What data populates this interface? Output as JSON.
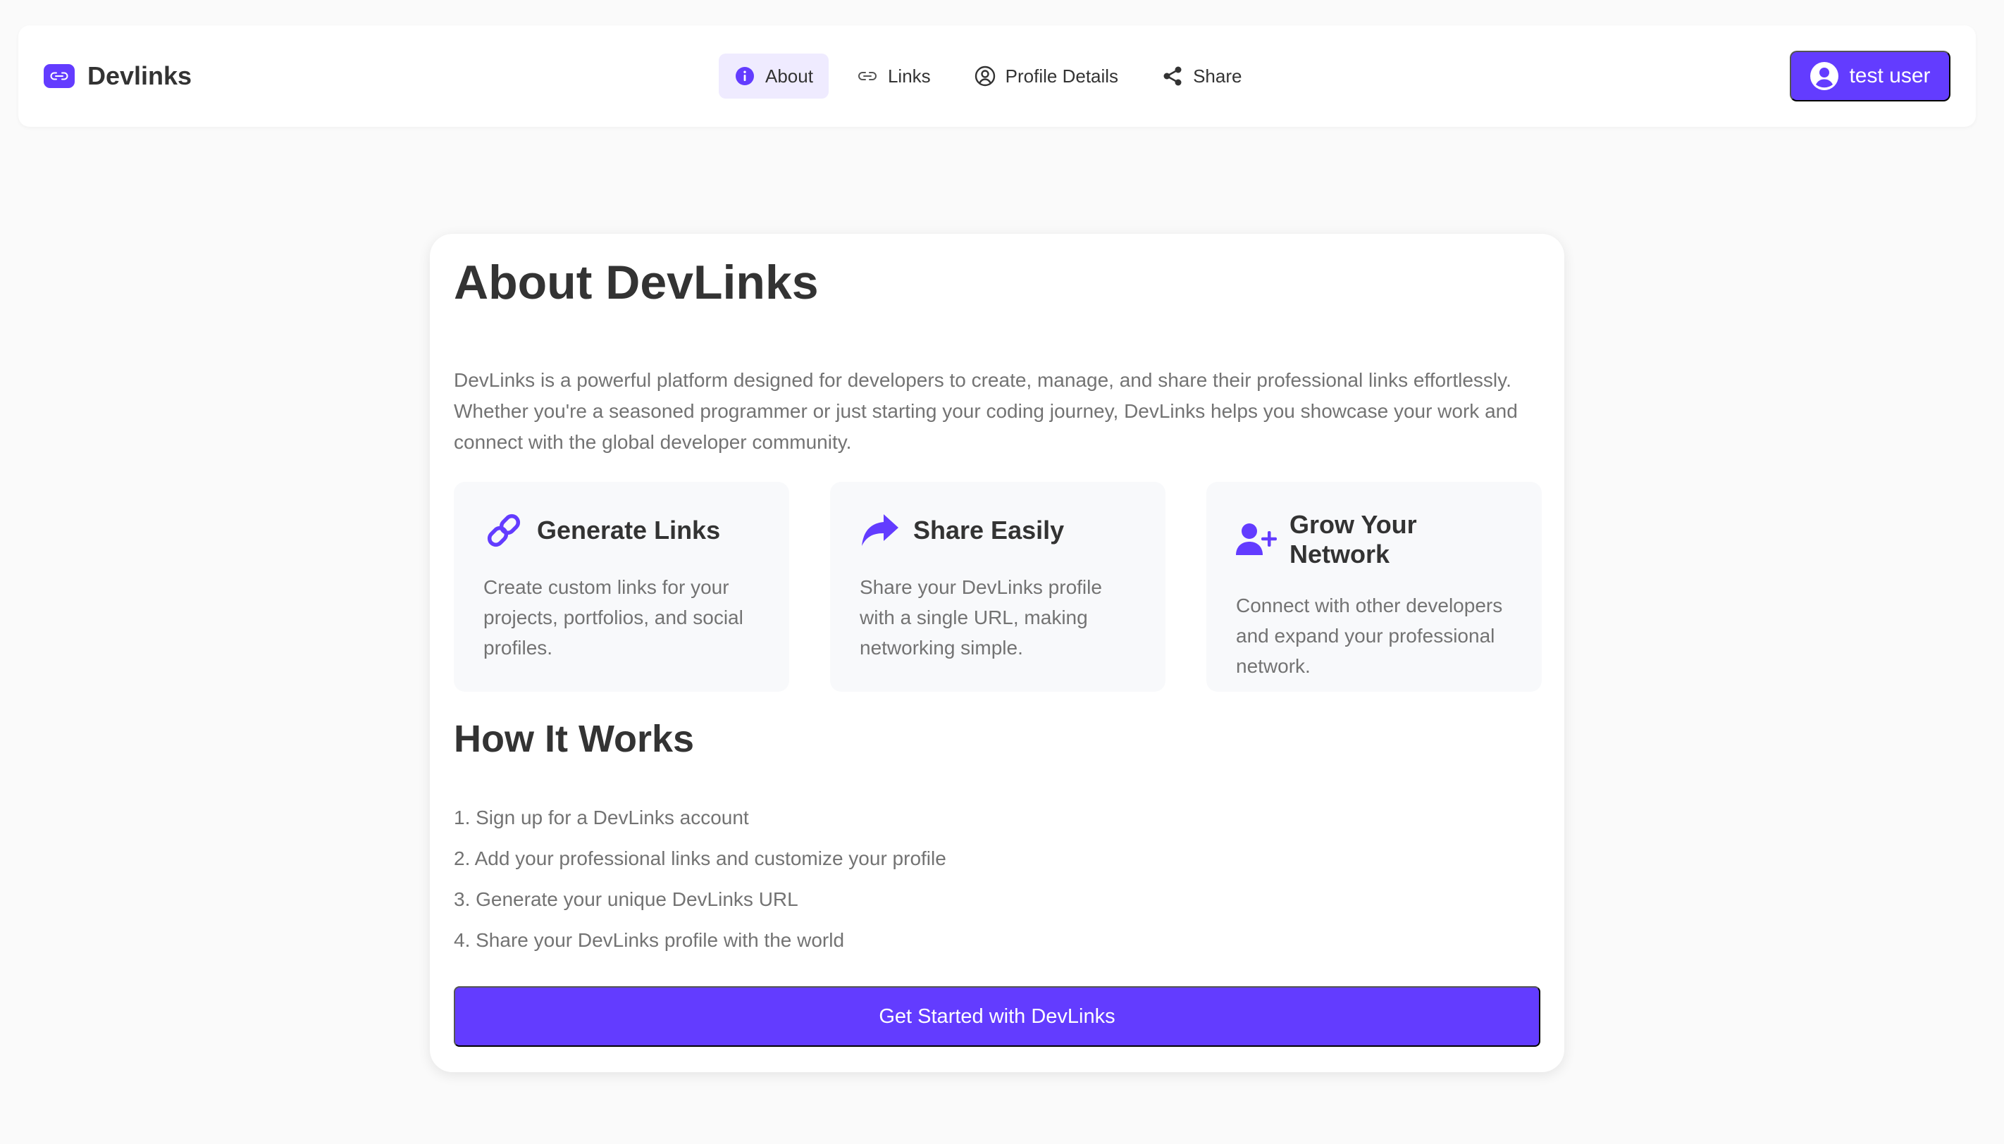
{
  "brand": {
    "name": "Devlinks",
    "logo_icon": "link-icon"
  },
  "nav": {
    "tabs": [
      {
        "label": "About",
        "icon": "info-icon",
        "active": true
      },
      {
        "label": "Links",
        "icon": "link-icon",
        "active": false
      },
      {
        "label": "Profile Details",
        "icon": "user-circle-icon",
        "active": false
      },
      {
        "label": "Share",
        "icon": "share-icon",
        "active": false
      }
    ]
  },
  "user": {
    "label": "test user",
    "icon": "user-circle-icon"
  },
  "about": {
    "title": "About DevLinks",
    "intro": "DevLinks is a powerful platform designed for developers to create, manage, and share their professional links effortlessly. Whether you're a seasoned programmer or just starting your coding journey, DevLinks helps you showcase your work and connect with the global developer community.",
    "features": [
      {
        "icon": "chain-link-icon",
        "title": "Generate Links",
        "description": "Create custom links for your projects, portfolios, and social profiles."
      },
      {
        "icon": "share-arrow-icon",
        "title": "Share Easily",
        "description": "Share your DevLinks profile with a single URL, making networking simple."
      },
      {
        "icon": "user-plus-icon",
        "title": "Grow Your Network",
        "description": "Connect with other developers and expand your professional network."
      }
    ],
    "how_title": "How It Works",
    "steps": [
      "1. Sign up for a DevLinks account",
      "2. Add your professional links and customize your profile",
      "3. Generate your unique DevLinks URL",
      "4. Share your DevLinks profile with the world"
    ],
    "cta_label": "Get Started with DevLinks"
  },
  "colors": {
    "accent": "#633cff",
    "accent_light": "#efebff",
    "text": "#333333",
    "muted": "#737373",
    "background": "#fafafa"
  }
}
